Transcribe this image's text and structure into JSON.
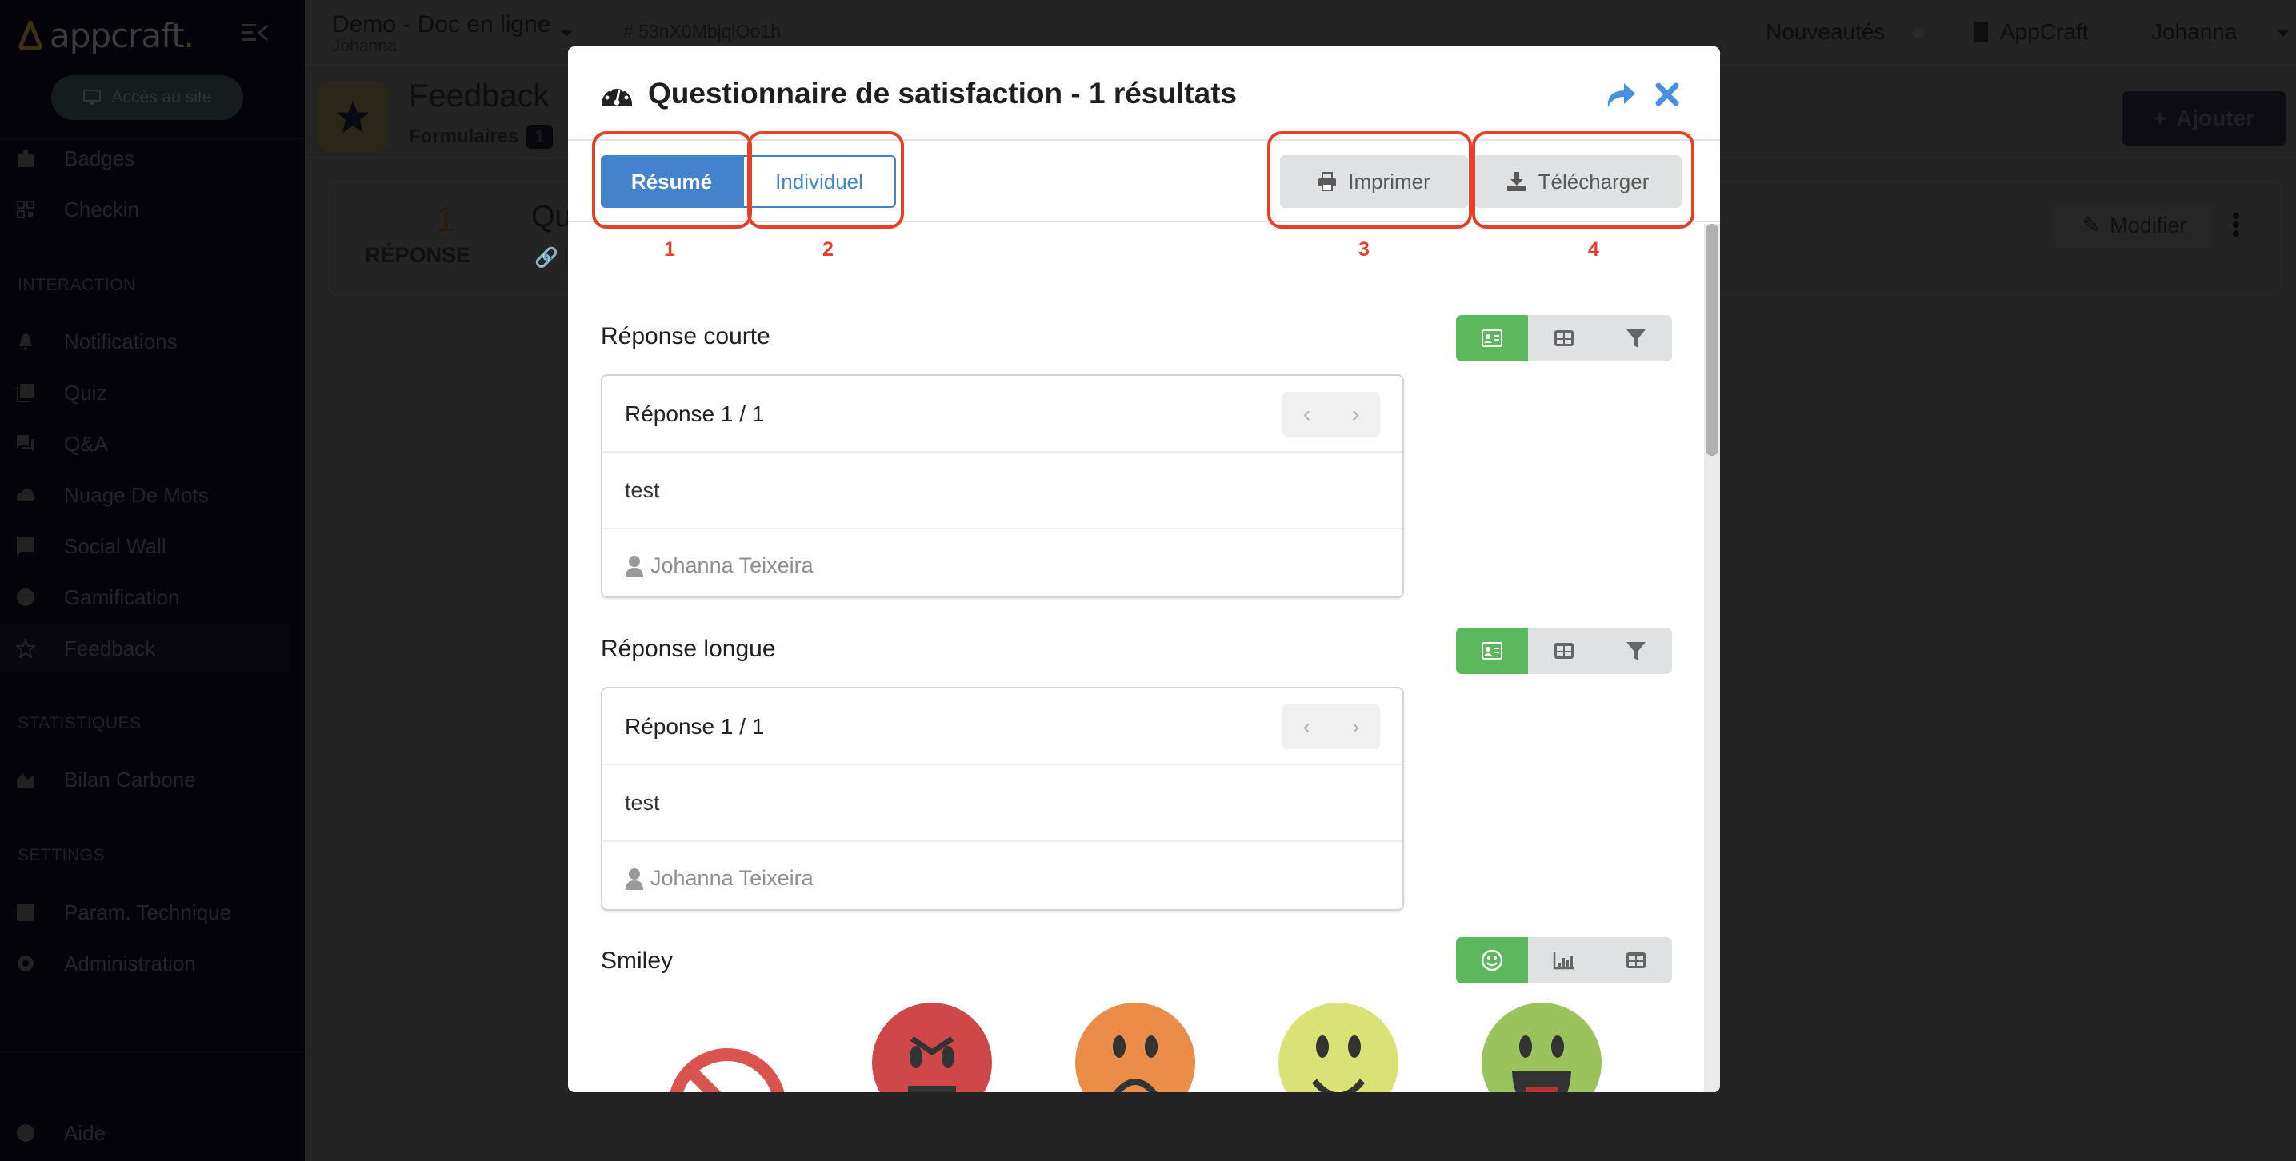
{
  "app": {
    "logo_text": "appcraft",
    "logo_dot": ".",
    "access_site_label": "Accès au site"
  },
  "sidebar": {
    "top_items": [
      {
        "label": "Badges",
        "icon": "badge-icon"
      },
      {
        "label": "Checkin",
        "icon": "qrcode-icon"
      }
    ],
    "sections": [
      {
        "title": "INTERACTION",
        "items": [
          {
            "label": "Notifications",
            "icon": "bell-icon"
          },
          {
            "label": "Quiz",
            "icon": "quiz-icon"
          },
          {
            "label": "Q&A",
            "icon": "chat-icon"
          },
          {
            "label": "Nuage De Mots",
            "icon": "cloud-check-icon"
          },
          {
            "label": "Social Wall",
            "icon": "image-chat-icon"
          },
          {
            "label": "Gamification",
            "icon": "star-circle-icon"
          },
          {
            "label": "Feedback",
            "icon": "star-half-icon",
            "active": true
          }
        ]
      },
      {
        "title": "STATISTIQUES",
        "items": [
          {
            "label": "Bilan Carbone",
            "icon": "chart-mountain-icon"
          }
        ]
      },
      {
        "title": "SETTINGS",
        "items": [
          {
            "label": "Param. Technique",
            "icon": "cog-box-icon"
          },
          {
            "label": "Administration",
            "icon": "cog-icon"
          }
        ]
      }
    ],
    "help_label": "Aide"
  },
  "topbar": {
    "project_name": "Demo - Doc en ligne",
    "project_user": "Johanna",
    "project_id": "# 53nX0MbjqlOo1h",
    "news_label": "Nouveautés",
    "org_label": "AppCraft",
    "user_label": "Johanna"
  },
  "page": {
    "title": "Feedback",
    "subtitle": "Formulaires",
    "subtitle_count": "1",
    "add_button": "Ajouter",
    "card": {
      "count": "1",
      "count_label": "RÉPONSE",
      "title_partial": "Qu",
      "link_partial": "l",
      "modify_button": "Modifier"
    }
  },
  "modal": {
    "title": "Questionnaire de satisfaction - 1 résultats",
    "tabs": {
      "summary": "Résumé",
      "individual": "Individuel",
      "active": "summary"
    },
    "actions": {
      "print": "Imprimer",
      "download": "Télécharger"
    },
    "annotations": [
      "1",
      "2",
      "3",
      "4"
    ],
    "questions": [
      {
        "title": "Réponse courte",
        "views": [
          "card-view",
          "table-view",
          "filter"
        ],
        "active_view": "card-view",
        "response_counter": "Réponse 1 / 1",
        "answer": "test",
        "author": "Johanna Teixeira"
      },
      {
        "title": "Réponse longue",
        "views": [
          "card-view",
          "table-view",
          "filter"
        ],
        "active_view": "card-view",
        "response_counter": "Réponse 1 / 1",
        "answer": "test",
        "author": "Johanna Teixeira"
      },
      {
        "title": "Smiley",
        "views": [
          "smiley-view",
          "bar-chart-view",
          "table-view"
        ],
        "active_view": "smiley-view",
        "options": [
          {
            "name": "no-answer",
            "color": "#d9534f"
          },
          {
            "name": "angry",
            "color": "#cf4848"
          },
          {
            "name": "sad",
            "color": "#e98d48"
          },
          {
            "name": "happy",
            "color": "#dbe275"
          },
          {
            "name": "very-happy",
            "color": "#9ac35e"
          }
        ]
      }
    ]
  },
  "colors": {
    "primary": "#4383cc",
    "success": "#5cb85c",
    "annotation": "#e64127",
    "close_icon": "#4a90e2"
  }
}
